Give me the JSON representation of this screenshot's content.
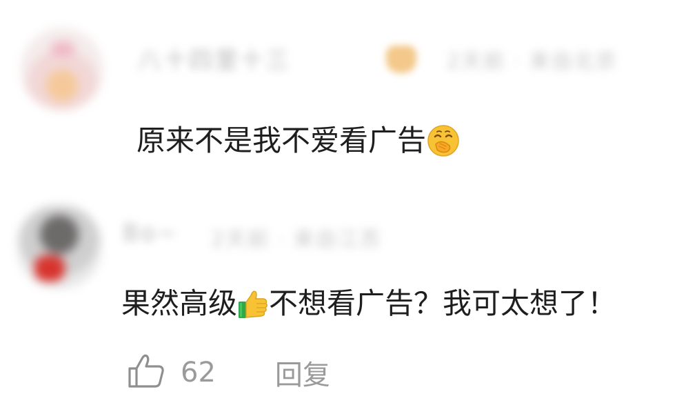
{
  "comments": [
    {
      "username": "八十四里十三",
      "meta": "2天前 · 来自北京",
      "text": "原来不是我不爱看广告",
      "emoji": "covering-mouth-face-icon"
    },
    {
      "username": "Bo~",
      "meta": "2天前 · 来自江苏",
      "text_before": "果然高级",
      "emoji": "thumbs-up-icon",
      "text_after": "不想看广告？我可太想了！",
      "like_count": "62",
      "reply_label": "回复"
    }
  ],
  "colors": {
    "text": "#1e1e1e",
    "muted": "#9a9a9a",
    "emoji_yellow": "#f7c234",
    "cuff_green": "#2fa84a"
  }
}
